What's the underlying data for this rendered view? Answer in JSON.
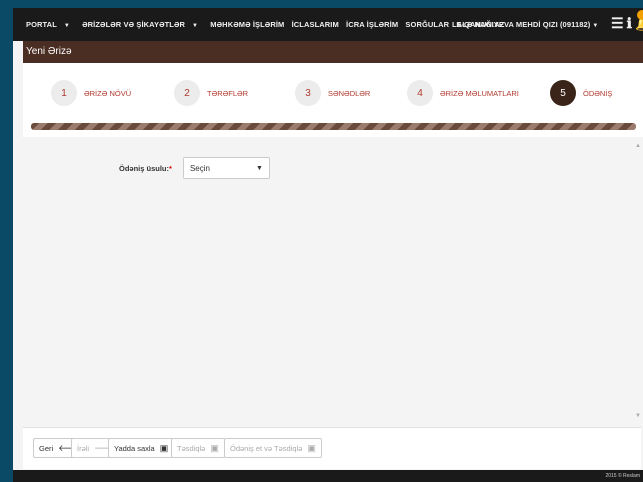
{
  "nav": {
    "items": [
      "PORTAL",
      "ƏRİZƏLƏR VƏ ŞİKAYƏTLƏR",
      "MƏHKƏMƏ İŞLƏRİM",
      "İCLASLARIM",
      "İCRA İŞLƏRİM",
      "SORĞULAR",
      "E-QANUN.AZ"
    ],
    "user": "LALƏ NAĞIYEVA MEHDİ QIZI (091182)"
  },
  "page_title": "Yeni Ərizə",
  "steps": [
    {
      "number": "1",
      "label": "ƏRİZƏ NÖVÜ"
    },
    {
      "number": "2",
      "label": "TƏRƏFLƏR"
    },
    {
      "number": "3",
      "label": "SƏNƏDLƏR"
    },
    {
      "number": "4",
      "label": "ƏRİZƏ MƏLUMATLARI"
    },
    {
      "number": "5",
      "label": "ÖDƏNİŞ"
    }
  ],
  "form": {
    "label": "Ödəniş üsulu:",
    "required_mark": "*",
    "select_value": "Seçin"
  },
  "buttons": {
    "back": "Geri",
    "forward": "İrəli",
    "save": "Yadda saxla",
    "confirm": "Təsdiqlə",
    "pay_confirm": "Ödəniş et və Təsdiqlə"
  },
  "footer": {
    "copyright": "2015 © Reslam"
  }
}
